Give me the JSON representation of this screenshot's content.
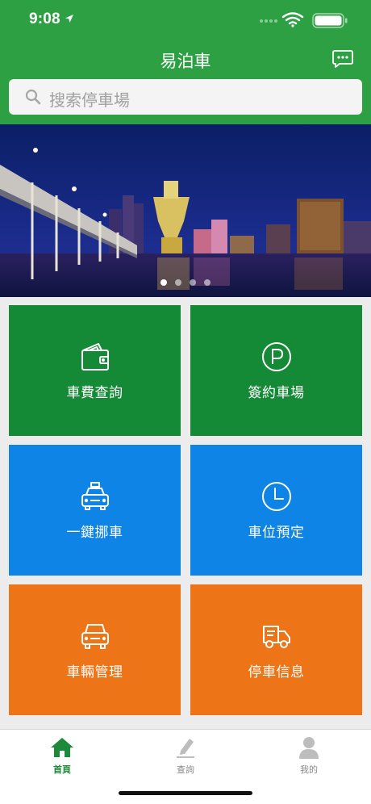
{
  "status_bar": {
    "time": "9:08"
  },
  "nav": {
    "title": "易泊車"
  },
  "search": {
    "placeholder": "搜索停車場"
  },
  "banner": {
    "page_count": 4,
    "active_page": 1
  },
  "tiles": [
    {
      "label": "車費查詢",
      "icon": "wallet-icon",
      "color": "#158a36"
    },
    {
      "label": "簽約車場",
      "icon": "parking-icon",
      "color": "#158a36"
    },
    {
      "label": "一鍵挪車",
      "icon": "taxi-icon",
      "color": "#0d84e6"
    },
    {
      "label": "車位預定",
      "icon": "clock-icon",
      "color": "#0d84e6"
    },
    {
      "label": "車輛管理",
      "icon": "car-icon",
      "color": "#ee7418"
    },
    {
      "label": "停車信息",
      "icon": "truck-info-icon",
      "color": "#ee7418"
    }
  ],
  "tabbar": [
    {
      "label": "首頁",
      "icon": "home-icon",
      "active": true
    },
    {
      "label": "查詢",
      "icon": "edit-icon",
      "active": false
    },
    {
      "label": "我的",
      "icon": "user-icon",
      "active": false
    }
  ],
  "colors": {
    "header": "#2ea044",
    "tab_active": "#1c8a3a"
  }
}
